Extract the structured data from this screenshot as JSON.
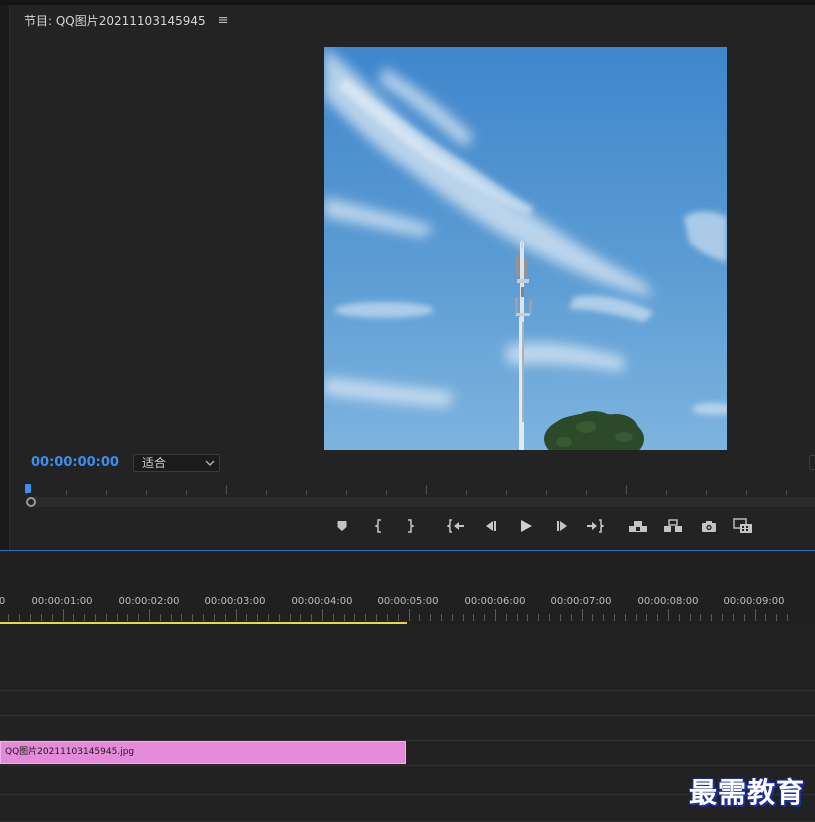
{
  "program_monitor": {
    "title": "节目: QQ图片20211103145945",
    "menu_icon": "hamburger-icon",
    "timecode": "00:00:00:00",
    "fit_select": {
      "selected": "适合",
      "icon": "chevron-down-icon"
    },
    "preview_image": "blue sky with wispy clouds, telecom tower and tree top",
    "playhead_position": 0,
    "transport_controls": [
      {
        "name": "add-marker-button",
        "icon": "marker-icon"
      },
      {
        "name": "mark-in-button",
        "icon": "mark-in-icon"
      },
      {
        "name": "mark-out-button",
        "icon": "mark-out-icon"
      },
      {
        "name": "go-to-in-button",
        "icon": "go-to-in-icon"
      },
      {
        "name": "step-back-button",
        "icon": "step-back-icon"
      },
      {
        "name": "play-button",
        "icon": "play-icon"
      },
      {
        "name": "step-forward-button",
        "icon": "step-forward-icon"
      },
      {
        "name": "go-to-out-button",
        "icon": "go-to-out-icon"
      },
      {
        "name": "lift-button",
        "icon": "lift-icon"
      },
      {
        "name": "extract-button",
        "icon": "extract-icon"
      },
      {
        "name": "export-frame-button",
        "icon": "camera-icon"
      },
      {
        "name": "comparison-view-button",
        "icon": "comparison-view-icon"
      }
    ]
  },
  "timeline": {
    "ruler_labels": [
      "0",
      "00:00:01:00",
      "00:00:02:00",
      "00:00:03:00",
      "00:00:04:00",
      "00:00:05:00",
      "00:00:06:00",
      "00:00:07:00",
      "00:00:08:00",
      "00:00:09:00"
    ],
    "work_area_end": "00:00:05:00",
    "clip": {
      "label": "QQ图片20211103145945.jpg",
      "color": "#e48ad8"
    }
  },
  "watermark": {
    "text": "最需教育"
  },
  "colors": {
    "accent": "#3c8ef0",
    "work_area": "#e8d94a",
    "clip": "#e48ad8",
    "panel_border": "#2b6fc4"
  }
}
